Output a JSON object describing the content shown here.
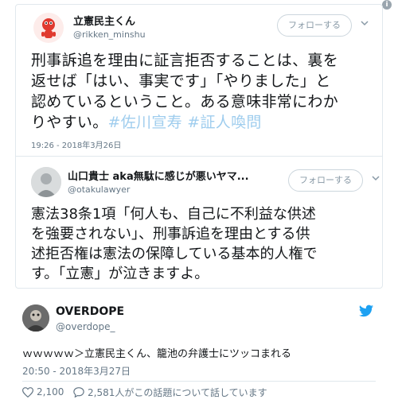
{
  "info_icon": "i",
  "quoted_card": {
    "tweet1": {
      "display_name": "立憲民主くん",
      "handle": "@rikken_minshu",
      "follow_label": "フォローする",
      "text_lines": [
        "刑事訴追を理由に証言拒否することは、裏を",
        "返せば「はい、事実です」「やりました」と",
        "認めているということ。ある意味非常にわか"
      ],
      "text_last": "りやすい。",
      "hashtags": [
        "#佐川宣寿",
        "#証人喚問"
      ],
      "timestamp": "19:26 - 2018年3月26日",
      "avatar_icon": "mascot-avatar"
    },
    "tweet2": {
      "display_name": "山口貴士 aka無駄に感じが悪いヤマ...",
      "handle": "@otakulawyer",
      "follow_label": "フォローする",
      "text_lines": [
        "憲法38条1項「何人も、自己に不利益な供述",
        "を強要されない」、刑事訴追を理由とする供",
        "述拒否権は憲法の保障している基本的人権で",
        "す。「立憲」が泣きますよ。"
      ],
      "avatar_icon": "portrait-avatar"
    }
  },
  "main_tweet": {
    "display_name": "OVERDOPE",
    "handle": "@overdope_",
    "text": "ｗｗｗｗｗ＞立憲民主くん、籠池の弁護士にツッコまれる",
    "timestamp": "20:50 - 2018年3月27日",
    "likes": "2,100",
    "conversation": "2,581人がこの話題について話しています",
    "avatar_icon": "photo-avatar",
    "brand_icon": "twitter-bird-icon"
  },
  "colors": {
    "hashtag": "#9fcdee",
    "twitter_blue": "#1da1f2",
    "secondary_text": "#657786",
    "border": "#e1e8ed"
  }
}
